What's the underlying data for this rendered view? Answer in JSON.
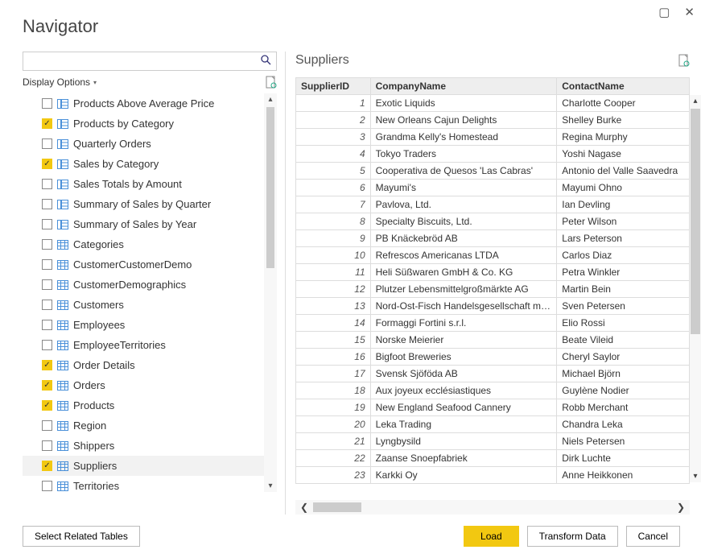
{
  "window": {
    "title": "Navigator"
  },
  "search": {
    "placeholder": ""
  },
  "options": {
    "label": "Display Options"
  },
  "tree": [
    {
      "label": "Products Above Average Price",
      "checked": false,
      "type": "view"
    },
    {
      "label": "Products by Category",
      "checked": true,
      "type": "view"
    },
    {
      "label": "Quarterly Orders",
      "checked": false,
      "type": "view"
    },
    {
      "label": "Sales by Category",
      "checked": true,
      "type": "view"
    },
    {
      "label": "Sales Totals by Amount",
      "checked": false,
      "type": "view"
    },
    {
      "label": "Summary of Sales by Quarter",
      "checked": false,
      "type": "view"
    },
    {
      "label": "Summary of Sales by Year",
      "checked": false,
      "type": "view"
    },
    {
      "label": "Categories",
      "checked": false,
      "type": "table"
    },
    {
      "label": "CustomerCustomerDemo",
      "checked": false,
      "type": "table"
    },
    {
      "label": "CustomerDemographics",
      "checked": false,
      "type": "table"
    },
    {
      "label": "Customers",
      "checked": false,
      "type": "table"
    },
    {
      "label": "Employees",
      "checked": false,
      "type": "table"
    },
    {
      "label": "EmployeeTerritories",
      "checked": false,
      "type": "table"
    },
    {
      "label": "Order Details",
      "checked": true,
      "type": "table"
    },
    {
      "label": "Orders",
      "checked": true,
      "type": "table"
    },
    {
      "label": "Products",
      "checked": true,
      "type": "table"
    },
    {
      "label": "Region",
      "checked": false,
      "type": "table"
    },
    {
      "label": "Shippers",
      "checked": false,
      "type": "table"
    },
    {
      "label": "Suppliers",
      "checked": true,
      "type": "table",
      "selected": true
    },
    {
      "label": "Territories",
      "checked": false,
      "type": "table"
    }
  ],
  "preview": {
    "title": "Suppliers",
    "columns": [
      "SupplierID",
      "CompanyName",
      "ContactName"
    ],
    "rows": [
      [
        "1",
        "Exotic Liquids",
        "Charlotte Cooper"
      ],
      [
        "2",
        "New Orleans Cajun Delights",
        "Shelley Burke"
      ],
      [
        "3",
        "Grandma Kelly's Homestead",
        "Regina Murphy"
      ],
      [
        "4",
        "Tokyo Traders",
        "Yoshi Nagase"
      ],
      [
        "5",
        "Cooperativa de Quesos 'Las Cabras'",
        "Antonio del Valle Saavedra"
      ],
      [
        "6",
        "Mayumi's",
        "Mayumi Ohno"
      ],
      [
        "7",
        "Pavlova, Ltd.",
        "Ian Devling"
      ],
      [
        "8",
        "Specialty Biscuits, Ltd.",
        "Peter Wilson"
      ],
      [
        "9",
        "PB Knäckebröd AB",
        "Lars Peterson"
      ],
      [
        "10",
        "Refrescos Americanas LTDA",
        "Carlos Diaz"
      ],
      [
        "11",
        "Heli Süßwaren GmbH & Co. KG",
        "Petra Winkler"
      ],
      [
        "12",
        "Plutzer Lebensmittelgroßmärkte AG",
        "Martin Bein"
      ],
      [
        "13",
        "Nord-Ost-Fisch Handelsgesellschaft mbH",
        "Sven Petersen"
      ],
      [
        "14",
        "Formaggi Fortini s.r.l.",
        "Elio Rossi"
      ],
      [
        "15",
        "Norske Meierier",
        "Beate Vileid"
      ],
      [
        "16",
        "Bigfoot Breweries",
        "Cheryl Saylor"
      ],
      [
        "17",
        "Svensk Sjöföda AB",
        "Michael Björn"
      ],
      [
        "18",
        "Aux joyeux ecclésiastiques",
        "Guylène Nodier"
      ],
      [
        "19",
        "New England Seafood Cannery",
        "Robb Merchant"
      ],
      [
        "20",
        "Leka Trading",
        "Chandra Leka"
      ],
      [
        "21",
        "Lyngbysild",
        "Niels Petersen"
      ],
      [
        "22",
        "Zaanse Snoepfabriek",
        "Dirk Luchte"
      ],
      [
        "23",
        "Karkki Oy",
        "Anne Heikkonen"
      ]
    ]
  },
  "footer": {
    "select_related": "Select Related Tables",
    "load": "Load",
    "transform": "Transform Data",
    "cancel": "Cancel"
  }
}
